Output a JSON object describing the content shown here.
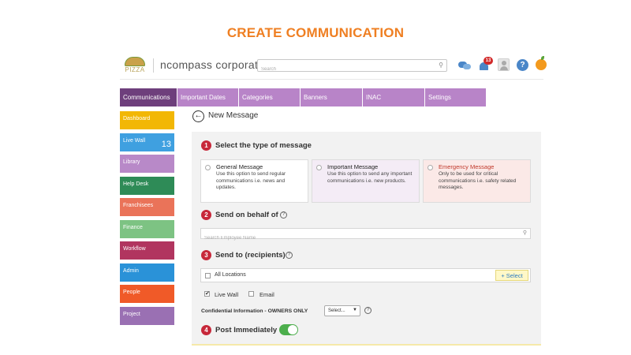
{
  "page_heading": "CREATE COMMUNICATION",
  "header": {
    "logo_text": "PIZZA",
    "brand": "ncompass corporate",
    "search_placeholder": "Search",
    "notification_count": "13",
    "help_symbol": "?"
  },
  "tabs": [
    {
      "label": "Communications",
      "active": true
    },
    {
      "label": "Important Dates",
      "active": false
    },
    {
      "label": "Categories",
      "active": false
    },
    {
      "label": "Banners",
      "active": false
    },
    {
      "label": "INAC",
      "active": false
    },
    {
      "label": "Settings",
      "active": false
    }
  ],
  "sidebar": {
    "items": [
      {
        "label": "Dashboard",
        "color": "#f2b705"
      },
      {
        "label": "Live Wall",
        "color": "#3fa0e0",
        "count": "13"
      },
      {
        "label": "Library",
        "color": "#b889c8"
      },
      {
        "label": "Help Desk",
        "color": "#2e8b57"
      },
      {
        "label": "Franchisees",
        "color": "#ea7359"
      },
      {
        "label": "Finance",
        "color": "#7dc383"
      },
      {
        "label": "Workflow",
        "color": "#b1355f"
      },
      {
        "label": "Admin",
        "color": "#2a92d8"
      },
      {
        "label": "People",
        "color": "#f05a28"
      },
      {
        "label": "Project",
        "color": "#9a70b3"
      }
    ]
  },
  "main": {
    "back_symbol": "←",
    "title": "New Message",
    "step1": {
      "number": "1",
      "title": "Select the type of message",
      "options": [
        {
          "title": "General Message",
          "desc": "Use this option to send regular communications i.e. news and updates."
        },
        {
          "title": "Important Message",
          "desc": "Use this option to send any important communications i.e. new products."
        },
        {
          "title": "Emergency Message",
          "desc": "Only to be used for critical communications i.e. safety related messages."
        }
      ]
    },
    "step2": {
      "number": "2",
      "title": "Send on behalf of",
      "placeholder": "Search Employee Name"
    },
    "step3": {
      "number": "3",
      "title": "Send to (recipients)",
      "all_locations": "All Locations",
      "select_button": "+ Select",
      "live_wall": "Live Wall",
      "live_wall_checked": true,
      "email": "Email",
      "email_checked": false,
      "confidential_label": "Confidential Information - OWNERS ONLY",
      "confidential_select": "Select..."
    },
    "step4": {
      "number": "4",
      "title": "Post Immediately",
      "toggle_on": true
    }
  },
  "colors": {
    "heading": "#ef7f22",
    "tab_bar": "#b884c8",
    "tab_active": "#6e3f7c",
    "step_badge": "#c7283a",
    "toggle_on": "#4cae4c"
  }
}
